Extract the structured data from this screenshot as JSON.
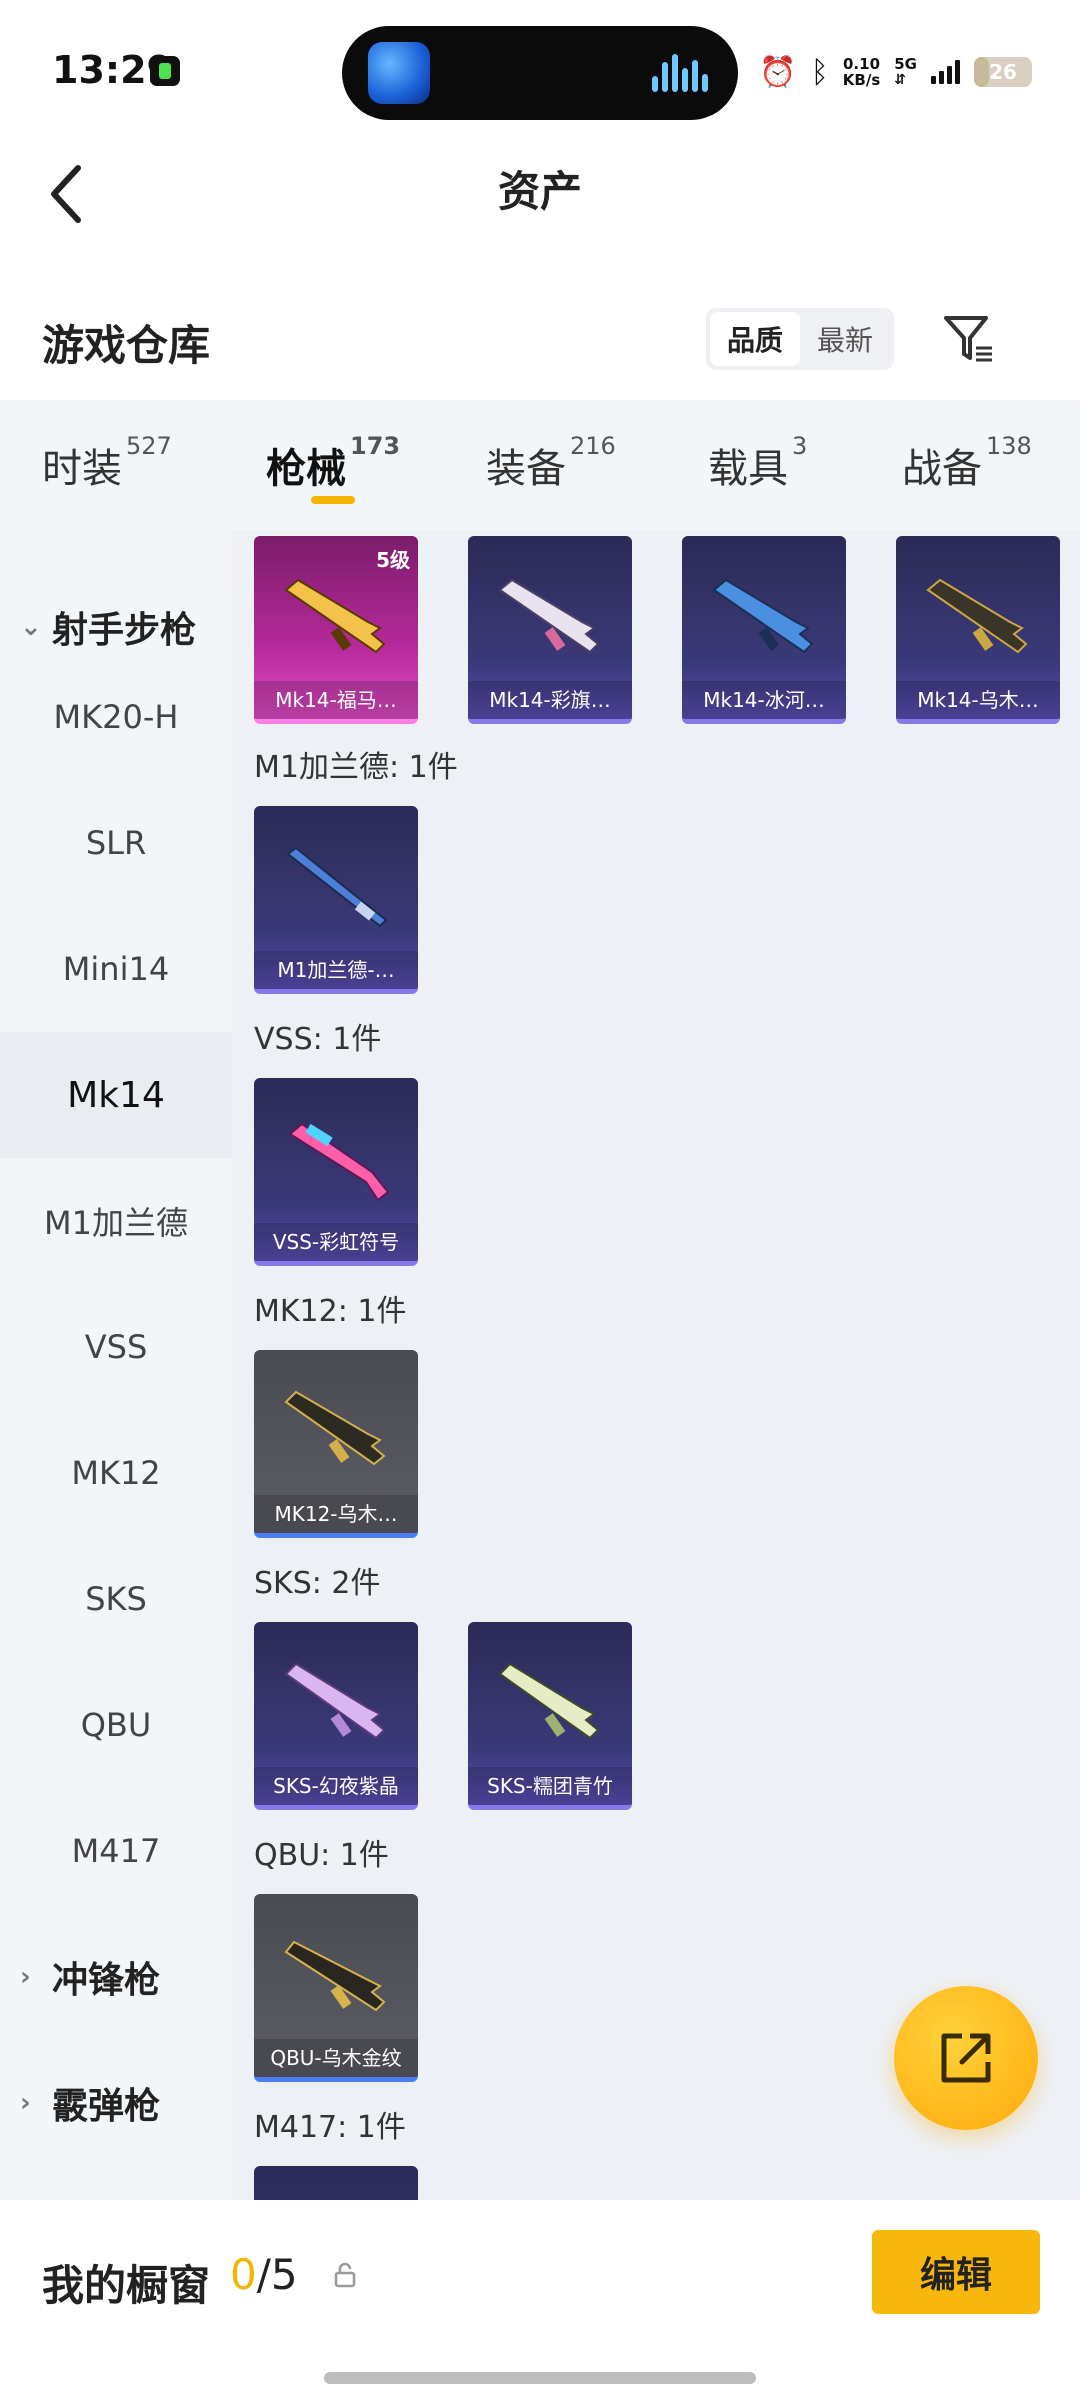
{
  "status_bar": {
    "time": "13:29",
    "speed_value": "0.10",
    "speed_unit": "KB/s",
    "network": "5G",
    "battery": "26",
    "battery_level": 0.26,
    "icons": [
      "alarm-icon",
      "bluetooth-icon",
      "signal-icon",
      "battery-icon"
    ]
  },
  "header": {
    "title": "资产"
  },
  "warehouse": {
    "title": "游戏仓库",
    "sort_options": [
      "品质",
      "最新"
    ],
    "sort_selected": "品质"
  },
  "tabs": [
    {
      "label": "时装",
      "count": "527"
    },
    {
      "label": "枪械",
      "count": "173",
      "active": true
    },
    {
      "label": "装备",
      "count": "216"
    },
    {
      "label": "载具",
      "count": "3"
    },
    {
      "label": "战备",
      "count": "138"
    }
  ],
  "sidebar": {
    "items": [
      {
        "label": "射手步枪",
        "type": "group",
        "expanded": true
      },
      {
        "label": "MK20-H"
      },
      {
        "label": "SLR"
      },
      {
        "label": "Mini14"
      },
      {
        "label": "Mk14",
        "active": true
      },
      {
        "label": "M1加兰德"
      },
      {
        "label": "VSS"
      },
      {
        "label": "MK12"
      },
      {
        "label": "SKS"
      },
      {
        "label": "QBU"
      },
      {
        "label": "M417"
      },
      {
        "label": "冲锋枪",
        "type": "group"
      },
      {
        "label": "霰弹枪",
        "type": "group"
      }
    ]
  },
  "content": {
    "mk14_cards": [
      {
        "name": "Mk14-福马…",
        "level": "5级",
        "style": "gold"
      },
      {
        "name": "Mk14-彩旗…",
        "style": "purple"
      },
      {
        "name": "Mk14-冰河…",
        "style": "purple"
      },
      {
        "name": "Mk14-乌木…",
        "style": "purple"
      }
    ],
    "sections": [
      {
        "title": "M1加兰德: 1件",
        "cards": [
          {
            "name": "M1加兰德-…",
            "style": "purple"
          }
        ]
      },
      {
        "title": "VSS: 1件",
        "cards": [
          {
            "name": "VSS-彩虹符号",
            "style": "purple"
          }
        ]
      },
      {
        "title": "MK12: 1件",
        "cards": [
          {
            "name": "MK12-乌木…",
            "style": "grey"
          }
        ]
      },
      {
        "title": "SKS: 2件",
        "cards": [
          {
            "name": "SKS-幻夜紫晶",
            "style": "purple"
          },
          {
            "name": "SKS-糯团青竹",
            "style": "purple"
          }
        ]
      },
      {
        "title": "QBU: 1件",
        "cards": [
          {
            "name": "QBU-乌木金纹",
            "style": "grey"
          }
        ]
      },
      {
        "title": "M417: 1件",
        "cards": [
          {
            "name": "",
            "style": "purple"
          }
        ]
      }
    ]
  },
  "bottom_bar": {
    "title": "我的橱窗",
    "current": "0",
    "separator": "/5",
    "edit_label": "编辑"
  },
  "colors": {
    "accent": "#f5b400",
    "tab_bg": "#f3f6f9",
    "content_bg": "#edf0f5"
  }
}
